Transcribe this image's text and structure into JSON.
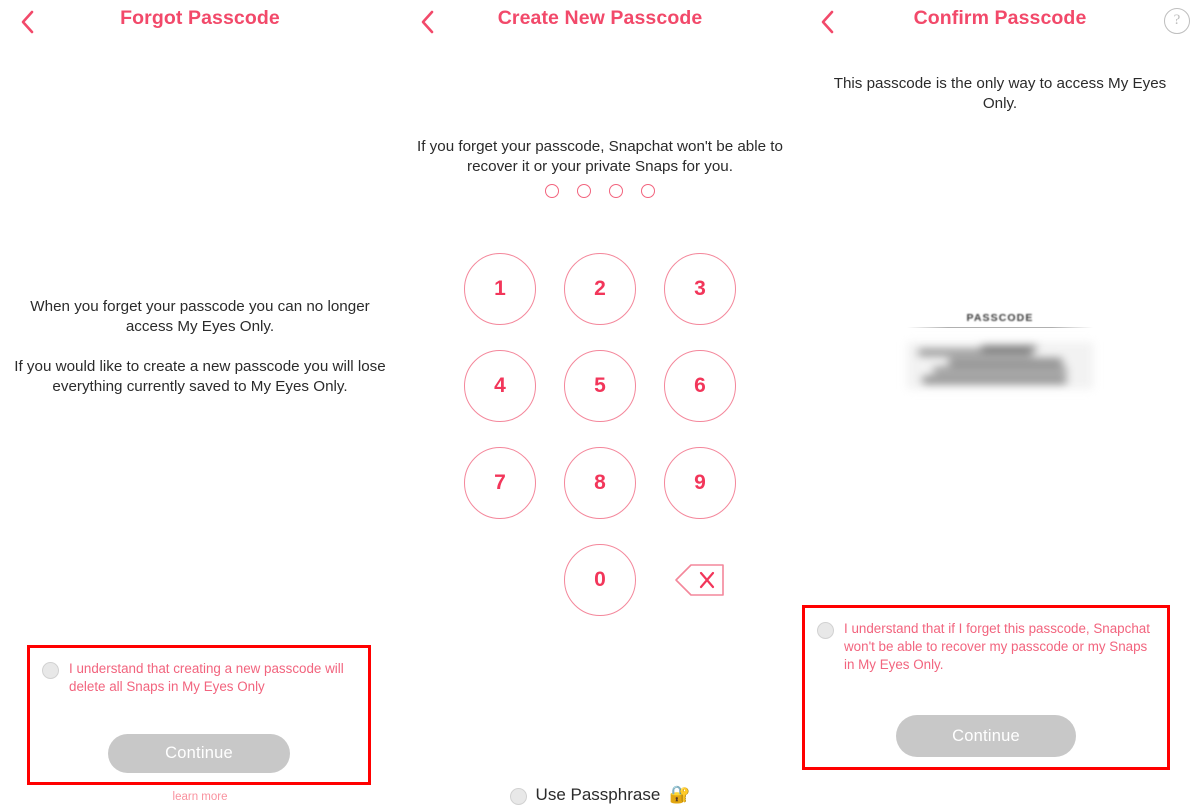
{
  "accent": {
    "pink": "#F2496A",
    "pink_light": "#F2647E",
    "pink_pale": "#F9929F",
    "annotation_red": "#FF0000",
    "button_gray": "#C8C8C8",
    "text_dark": "#2B2B2B"
  },
  "panels": [
    {
      "id": "forgot-passcode",
      "nav": {
        "back_icon": "chevron-left-icon",
        "title": "Forgot Passcode",
        "help_icon": null,
        "help_glyph": ""
      },
      "body": [
        "When you forget your passcode you can no longer access My Eyes Only.",
        "If you would like to create a new passcode you will lose everything currently saved to My Eyes Only."
      ],
      "consent": {
        "checkbox_icon": "radio-unchecked-icon",
        "text": "I understand that creating a new passcode will delete all Snaps in My Eyes Only"
      },
      "continue_label": "Continue",
      "footer_link": "learn more"
    },
    {
      "id": "create-new-passcode",
      "nav": {
        "back_icon": "chevron-left-icon",
        "title": "Create New Passcode"
      },
      "body": [
        "If you forget your passcode, Snapchat won't be able to recover it or your private Snaps for you."
      ],
      "passcode_dots": {
        "count": 4,
        "filled": 0
      },
      "keypad": {
        "keys": [
          "1",
          "2",
          "3",
          "4",
          "5",
          "6",
          "7",
          "8",
          "9",
          "",
          "0",
          ""
        ],
        "backspace_icon": "backspace-delete-icon"
      },
      "passphrase": {
        "checkbox_icon": "radio-unchecked-icon",
        "label": "Use Passphrase",
        "emoji": "🔐"
      }
    },
    {
      "id": "confirm-passcode",
      "nav": {
        "back_icon": "chevron-left-icon",
        "title": "Confirm Passcode",
        "help_icon": "help-question-icon",
        "help_glyph": "?"
      },
      "body": [
        "This passcode is the only way to access My Eyes Only."
      ],
      "passcode_field": {
        "label": "PASSCODE",
        "value_redacted": true,
        "value": ""
      },
      "consent": {
        "checkbox_icon": "radio-unchecked-icon",
        "text": "I understand that if I forget this passcode, Snapchat won't be able to recover my passcode or my Snaps in My Eyes Only."
      },
      "continue_label": "Continue"
    }
  ]
}
